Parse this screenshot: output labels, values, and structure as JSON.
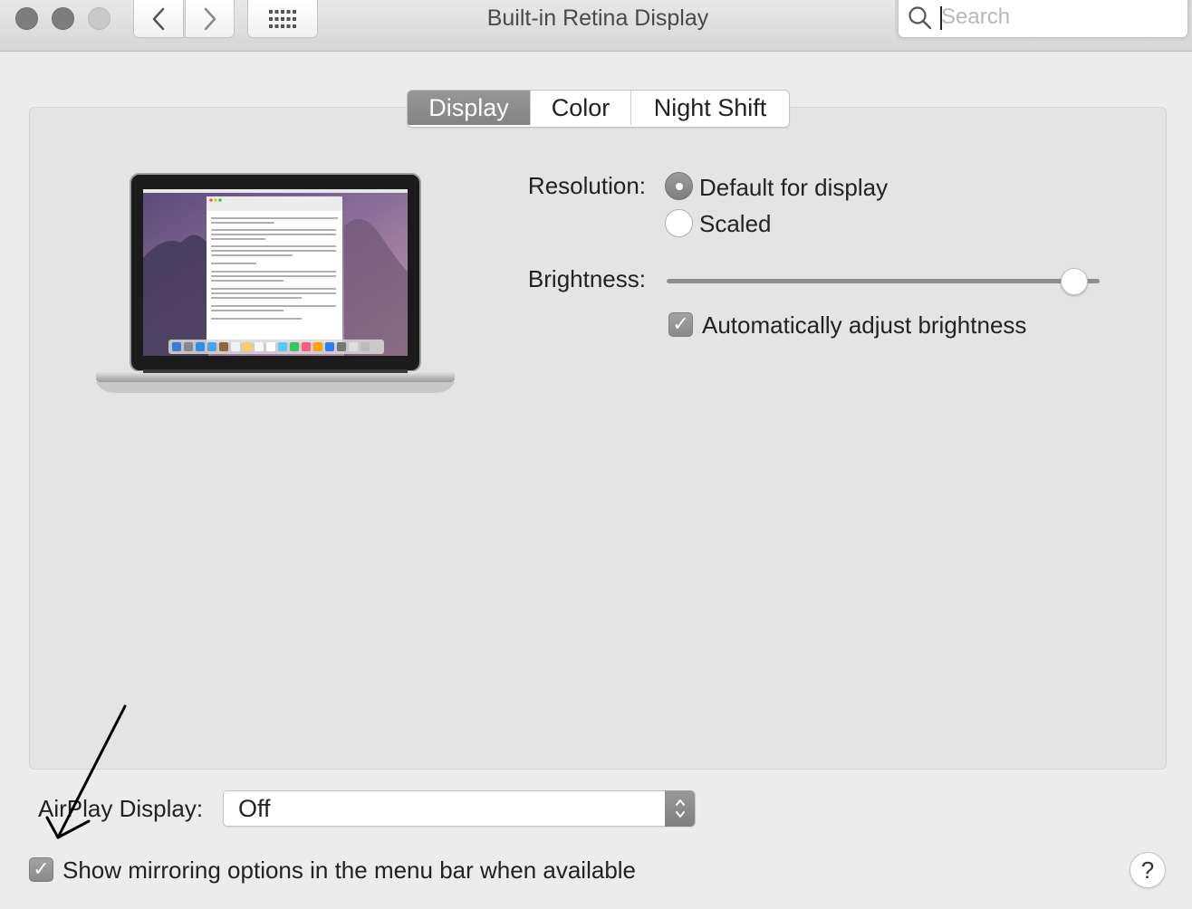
{
  "window": {
    "title": "Built-in Retina Display",
    "search_placeholder": "Search"
  },
  "tabs": [
    {
      "label": "Display",
      "active": true
    },
    {
      "label": "Color",
      "active": false
    },
    {
      "label": "Night Shift",
      "active": false
    }
  ],
  "resolution": {
    "label": "Resolution:",
    "options": [
      {
        "label": "Default for display",
        "selected": true
      },
      {
        "label": "Scaled",
        "selected": false
      }
    ]
  },
  "brightness": {
    "label": "Brightness:",
    "level": 0.97,
    "auto_label": "Automatically adjust brightness",
    "auto_checked": true
  },
  "airplay": {
    "label": "AirPlay Display:",
    "value": "Off"
  },
  "mirroring": {
    "label": "Show mirroring options in the menu bar when available",
    "checked": true
  },
  "help": {
    "label": "?"
  },
  "colors": {
    "accent_gray": "#8a8a8a",
    "window_bg": "#ececec",
    "panel_bg": "#e4e4e4"
  }
}
